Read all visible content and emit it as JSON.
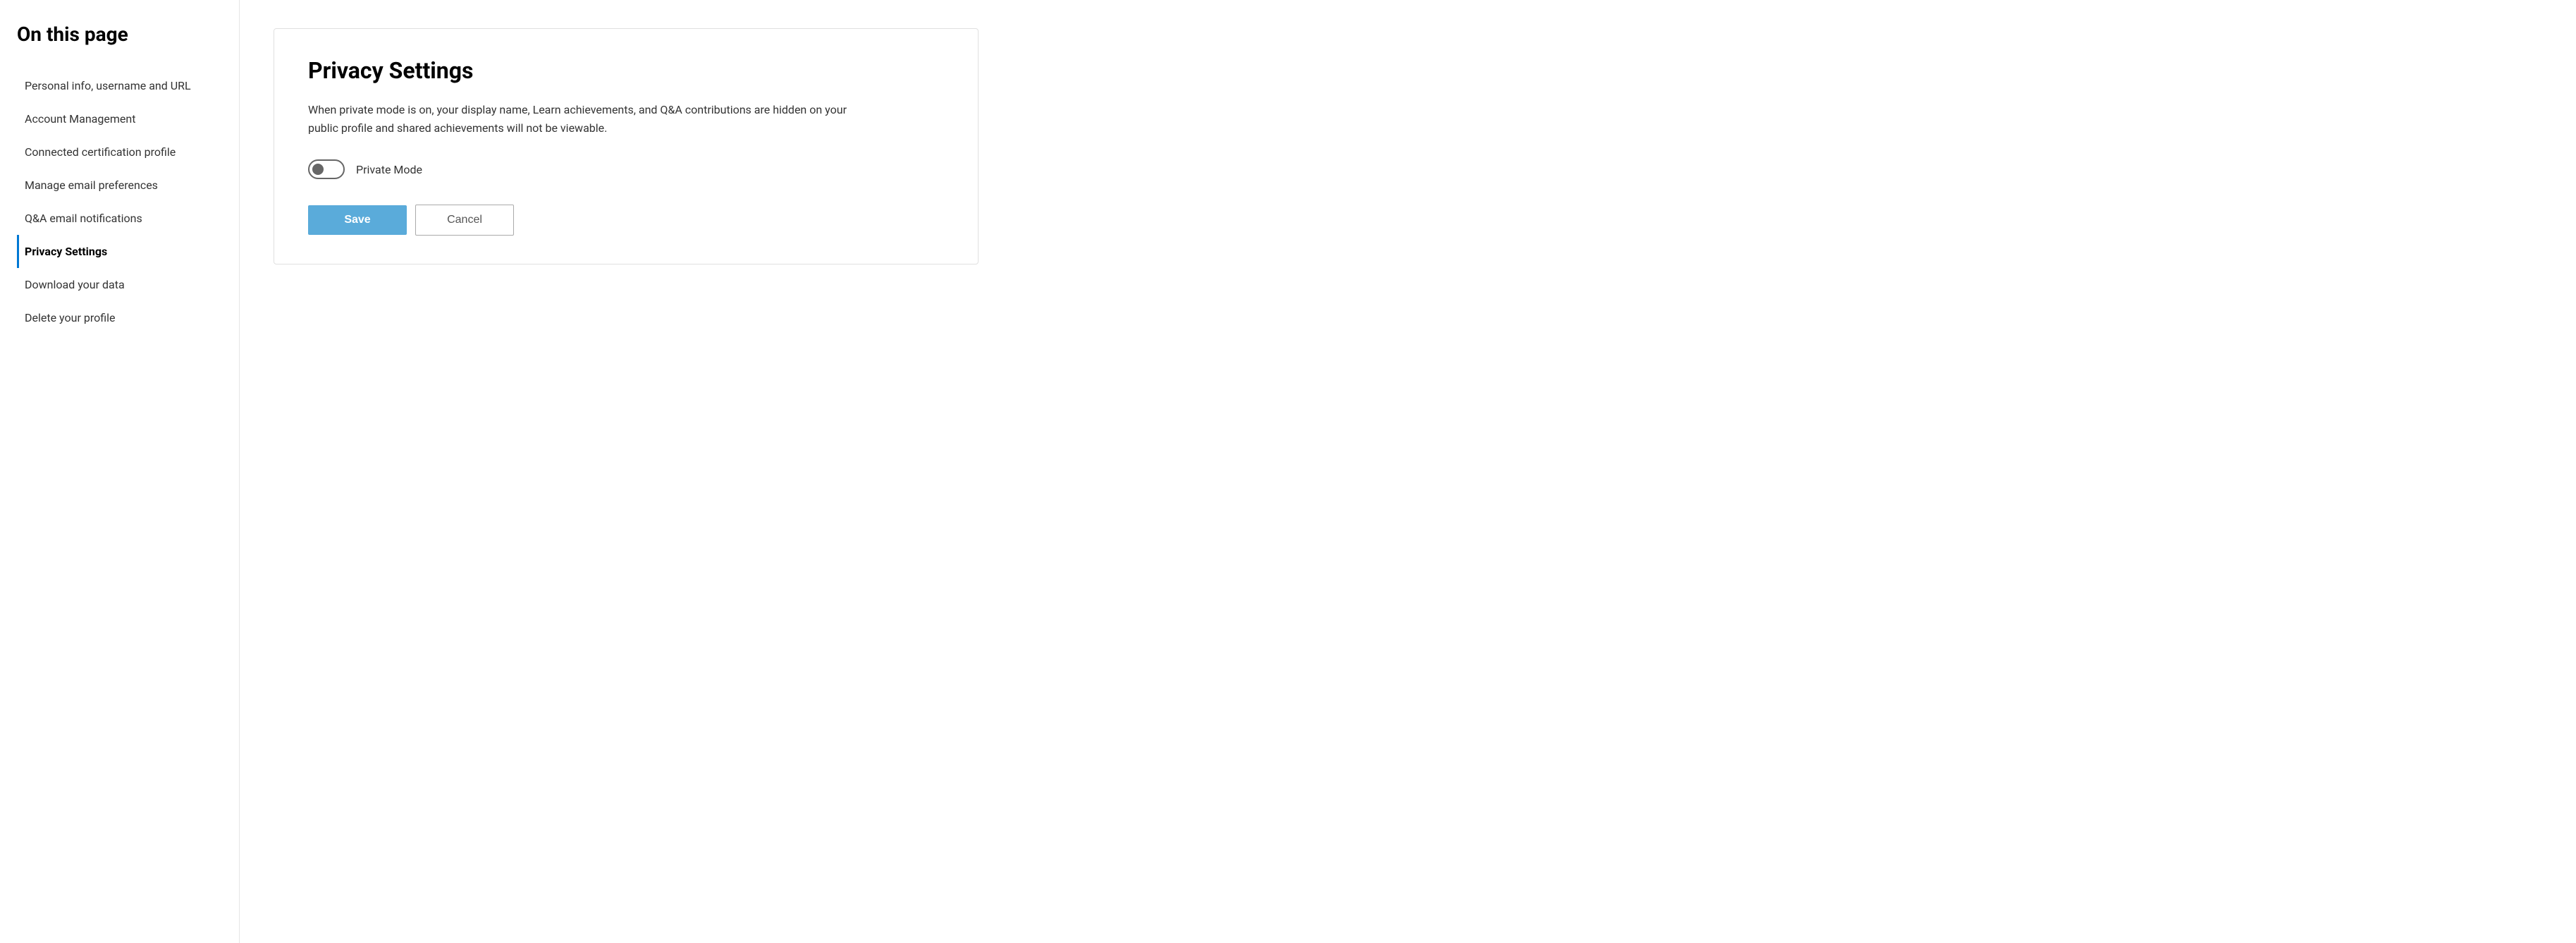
{
  "sidebar": {
    "title": "On this page",
    "items": [
      {
        "id": "personal-info",
        "label": "Personal info, username and URL",
        "active": false
      },
      {
        "id": "account-management",
        "label": "Account Management",
        "active": false
      },
      {
        "id": "connected-certification",
        "label": "Connected certification profile",
        "active": false
      },
      {
        "id": "manage-email",
        "label": "Manage email preferences",
        "active": false
      },
      {
        "id": "qa-email",
        "label": "Q&A email notifications",
        "active": false
      },
      {
        "id": "privacy-settings",
        "label": "Privacy Settings",
        "active": true
      },
      {
        "id": "download-data",
        "label": "Download your data",
        "active": false
      },
      {
        "id": "delete-profile",
        "label": "Delete your profile",
        "active": false
      }
    ]
  },
  "main": {
    "section": {
      "heading": "Privacy Settings",
      "description": "When private mode is on, your display name, Learn achievements, and Q&A contributions are hidden on your public profile and shared achievements will not be viewable.",
      "toggle_label": "Private Mode",
      "toggle_state": false,
      "save_button": "Save",
      "cancel_button": "Cancel"
    }
  }
}
